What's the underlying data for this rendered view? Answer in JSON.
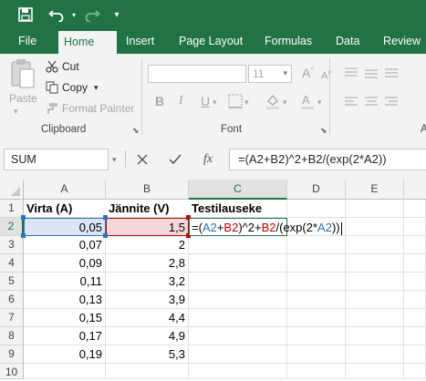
{
  "quick_access": {
    "save_icon": "save-icon",
    "undo_icon": "undo-icon",
    "redo_icon": "redo-icon",
    "customize_icon": "customize-icon"
  },
  "tabs": [
    "File",
    "Home",
    "Insert",
    "Page Layout",
    "Formulas",
    "Data",
    "Review"
  ],
  "active_tab": "Home",
  "clipboard": {
    "paste_label": "Paste",
    "cut_label": "Cut",
    "copy_label": "Copy",
    "format_painter_label": "Format Painter",
    "group_label": "Clipboard"
  },
  "font": {
    "font_name": "",
    "font_size": "11",
    "bold": "B",
    "italic": "I",
    "underline": "U",
    "group_label": "Font"
  },
  "formula_bar": {
    "name_box": "SUM",
    "fx_label": "fx",
    "formula": "=(A2+B2)^2+B2/(exp(2*A2))"
  },
  "columns": [
    "A",
    "B",
    "C",
    "D",
    "E"
  ],
  "rows": [
    "1",
    "2",
    "3",
    "4",
    "5",
    "6",
    "7",
    "8",
    "9",
    "10"
  ],
  "headers": {
    "a1": "Virta (A)",
    "b1": "Jännite (V)",
    "c1": "Testilauseke"
  },
  "data_a": [
    "0,05",
    "0,07",
    "0,09",
    "0,11",
    "0,13",
    "0,15",
    "0,17",
    "0,19"
  ],
  "data_b": [
    "1,5",
    "2",
    "2,8",
    "3,2",
    "3,9",
    "4,4",
    "4,9",
    "5,3"
  ],
  "edit_cell": {
    "p1": "=(",
    "ref1": "A2",
    "p2": "+",
    "ref2": "B2",
    "p3": ")^2+",
    "ref3": "B2",
    "p4": "/(exp(2*",
    "ref4": "A2",
    "p5": "))"
  },
  "colors": {
    "brand": "#217346",
    "ref_blue": "#2e75b6",
    "ref_red": "#c00000"
  }
}
